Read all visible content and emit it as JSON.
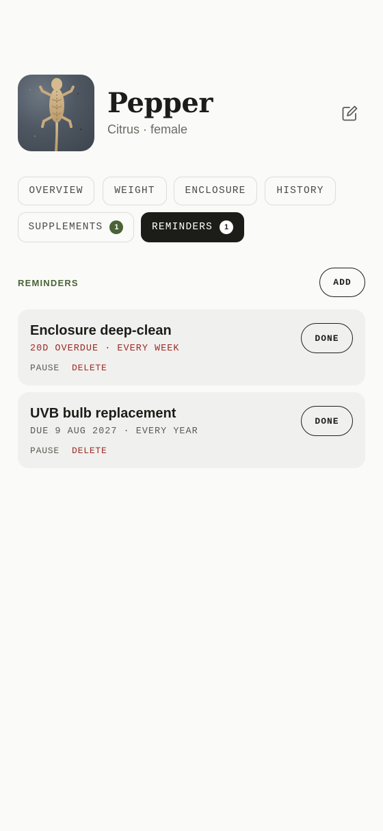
{
  "pet": {
    "name": "Pepper",
    "morph": "Citrus",
    "separator": "·",
    "sex": "female",
    "avatar_icon": "bearded-dragon-photo",
    "edit_icon": "edit-icon"
  },
  "tabs": [
    {
      "label": "OVERVIEW",
      "active": false
    },
    {
      "label": "WEIGHT",
      "active": false
    },
    {
      "label": "ENCLOSURE",
      "active": false
    },
    {
      "label": "HISTORY",
      "active": false
    },
    {
      "label": "SUPPLEMENTS",
      "badge": "1",
      "active": false
    },
    {
      "label": "REMINDERS",
      "badge": "1",
      "active": true
    }
  ],
  "reminders_section": {
    "title": "REMINDERS",
    "add_label": "ADD"
  },
  "reminders": [
    {
      "title": "Enclosure deep-clean",
      "meta": "20D OVERDUE · EVERY WEEK",
      "overdue": true,
      "pause_label": "PAUSE",
      "delete_label": "DELETE",
      "done_label": "DONE"
    },
    {
      "title": "UVB bulb replacement",
      "meta": "DUE 9 AUG 2027 · EVERY YEAR",
      "overdue": false,
      "pause_label": "PAUSE",
      "delete_label": "DELETE",
      "done_label": "DONE"
    }
  ],
  "colors": {
    "background": "#fafaf9",
    "ink": "#1c1c18",
    "accent_green": "#4a6236",
    "danger_red": "#9c2a25",
    "card": "#f0f0ee"
  }
}
